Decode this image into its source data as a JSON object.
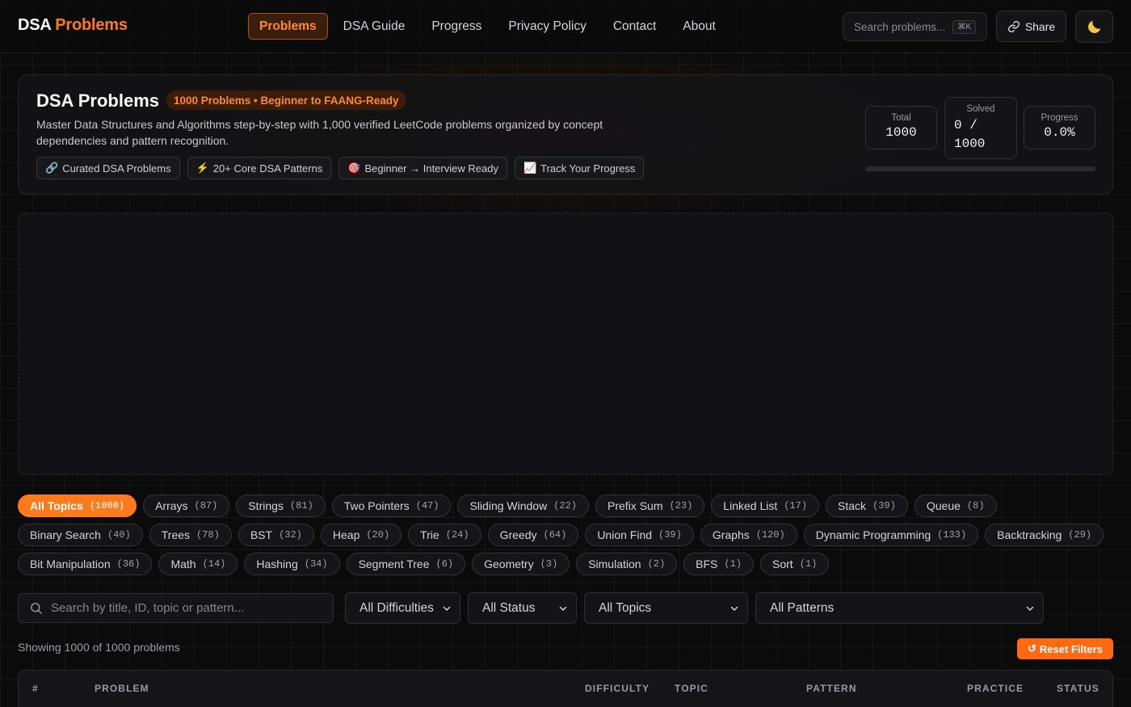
{
  "brand": {
    "part1": "DSA",
    "part2": "Problems"
  },
  "nav": [
    {
      "label": "Problems",
      "active": true
    },
    {
      "label": "DSA Guide"
    },
    {
      "label": "Progress"
    },
    {
      "label": "Privacy Policy"
    },
    {
      "label": "Contact"
    },
    {
      "label": "About"
    }
  ],
  "header_search": {
    "placeholder": "Search problems...",
    "shortcut": "⌘K"
  },
  "share_label": "Share",
  "theme_icon": "moon-icon",
  "hero": {
    "title": "DSA Problems",
    "badge": "1000 Problems • Beginner to FAANG-Ready",
    "description": "Master Data Structures and Algorithms step-by-step with 1,000 verified LeetCode problems organized by concept dependencies and pattern recognition.",
    "chips": [
      {
        "icon": "🔗",
        "label": "Curated DSA Problems"
      },
      {
        "icon": "⚡",
        "label": "20+ Core DSA Patterns"
      },
      {
        "icon": "🎯",
        "label": "Beginner → Interview Ready"
      },
      {
        "icon": "📈",
        "label": "Track Your Progress"
      }
    ],
    "stats": {
      "total_label": "Total",
      "total_value": "1000",
      "solved_label": "Solved",
      "solved_value": "0 /\n1000",
      "progress_label": "Progress",
      "progress_value": "0.0%",
      "progress_fraction": 0.0
    }
  },
  "topics": [
    {
      "label": "All Topics",
      "count": "(1000)",
      "active": true
    },
    {
      "label": "Arrays",
      "count": "(87)"
    },
    {
      "label": "Strings",
      "count": "(81)"
    },
    {
      "label": "Two Pointers",
      "count": "(47)"
    },
    {
      "label": "Sliding Window",
      "count": "(22)"
    },
    {
      "label": "Prefix Sum",
      "count": "(23)"
    },
    {
      "label": "Linked List",
      "count": "(17)"
    },
    {
      "label": "Stack",
      "count": "(39)"
    },
    {
      "label": "Queue",
      "count": "(8)"
    },
    {
      "label": "Binary Search",
      "count": "(40)"
    },
    {
      "label": "Trees",
      "count": "(78)"
    },
    {
      "label": "BST",
      "count": "(32)"
    },
    {
      "label": "Heap",
      "count": "(20)"
    },
    {
      "label": "Trie",
      "count": "(24)"
    },
    {
      "label": "Greedy",
      "count": "(64)"
    },
    {
      "label": "Union Find",
      "count": "(39)"
    },
    {
      "label": "Graphs",
      "count": "(120)"
    },
    {
      "label": "Dynamic Programming",
      "count": "(133)"
    },
    {
      "label": "Backtracking",
      "count": "(29)"
    },
    {
      "label": "Bit Manipulation",
      "count": "(36)"
    },
    {
      "label": "Math",
      "count": "(14)"
    },
    {
      "label": "Hashing",
      "count": "(34)"
    },
    {
      "label": "Segment Tree",
      "count": "(6)"
    },
    {
      "label": "Geometry",
      "count": "(3)"
    },
    {
      "label": "Simulation",
      "count": "(2)"
    },
    {
      "label": "BFS",
      "count": "(1)"
    },
    {
      "label": "Sort",
      "count": "(1)"
    }
  ],
  "filters": {
    "search_placeholder": "Search by title, ID, topic or pattern...",
    "difficulty": "All Difficulties",
    "status": "All Status",
    "topics": "All Topics",
    "patterns": "All Patterns"
  },
  "showing": "Showing 1000 of 1000 problems",
  "reset_label": "Reset Filters",
  "table_headers": {
    "num": "#",
    "problem": "PROBLEM",
    "difficulty": "DIFFICULTY",
    "topic": "TOPIC",
    "pattern": "PATTERN",
    "practice": "PRACTICE",
    "status": "STATUS"
  },
  "colors": {
    "accent": "#ff7a1a",
    "background": "#0b0b0c"
  }
}
